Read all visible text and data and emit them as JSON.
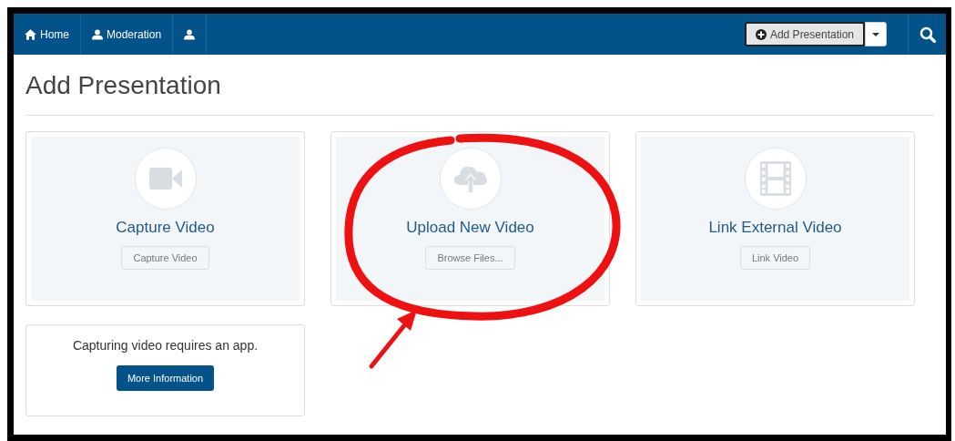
{
  "navbar": {
    "items": [
      {
        "kind": "home",
        "label": "Home"
      },
      {
        "kind": "user",
        "label": "Moderation"
      },
      {
        "kind": "user"
      }
    ],
    "add_button": {
      "label": "Add Presentation"
    }
  },
  "page_title": "Add Presentation",
  "options": [
    {
      "kind": "camera",
      "title": "Capture Video",
      "button": "Capture Video"
    },
    {
      "kind": "upload",
      "title": "Upload New Video",
      "button": "Browse Files..."
    },
    {
      "kind": "film",
      "title": "Link External Video",
      "button": "Link Video"
    }
  ],
  "notice": {
    "text": "Capturing video requires an app.",
    "button": "More Information"
  }
}
